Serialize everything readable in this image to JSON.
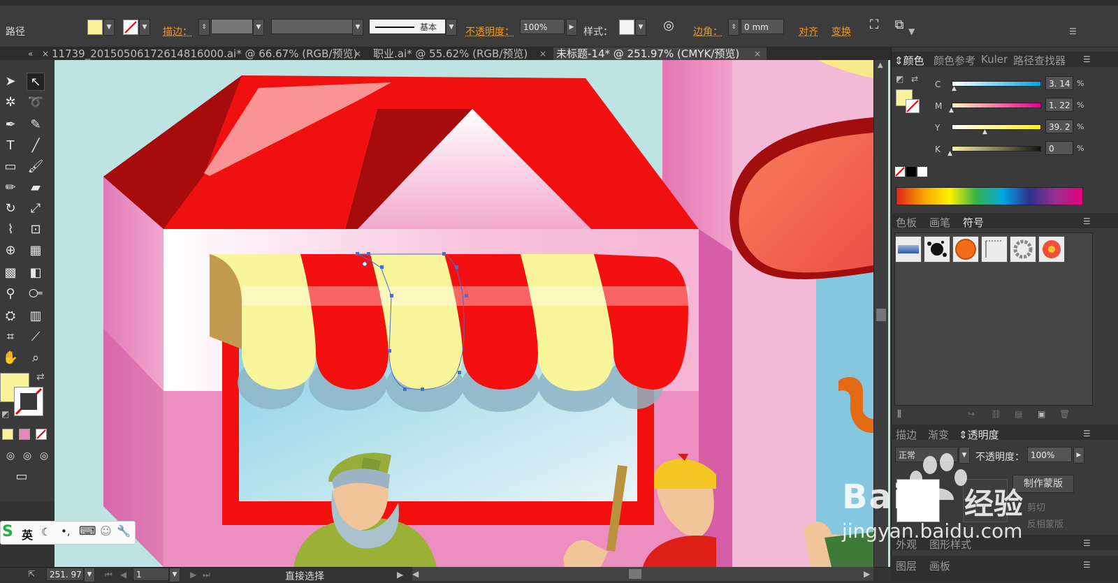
{
  "control_bar": {
    "object_type": "路径",
    "stroke_label": "描边：",
    "stroke_profile": "基本",
    "opacity_label": "不透明度：",
    "opacity_value": "100%",
    "style_label": "样式：",
    "corner_label": "边角：",
    "corner_value": "0 mm",
    "align_label": "对齐",
    "transform_label": "变换",
    "fill_color": "#f8f29a"
  },
  "tabs": [
    {
      "label": "11739_20150506172614816000.ai* @ 66.67% (RGB/预览)"
    },
    {
      "label": "职业.ai* @ 55.62% (RGB/预览)"
    },
    {
      "label": "未标题-14* @ 251.97% (CMYK/预览)"
    }
  ],
  "color_panel": {
    "tabs": [
      "颜色",
      "颜色参考",
      "Kuler",
      "路径查找器"
    ],
    "channels": [
      {
        "name": "C",
        "value": "3. 14",
        "pos": 0.03
      },
      {
        "name": "M",
        "value": "1. 22",
        "pos": 0.01
      },
      {
        "name": "Y",
        "value": "39. 2",
        "pos": 0.39
      },
      {
        "name": "K",
        "value": "0",
        "pos": 0.0
      }
    ],
    "percent": "%"
  },
  "symbols_panel": {
    "tabs": [
      "色板",
      "画笔",
      "符号"
    ]
  },
  "transparency_panel": {
    "tabs": [
      "描边",
      "渐变",
      "透明度"
    ],
    "blend_mode": "正常",
    "opacity_label": "不透明度：",
    "opacity_value": "100%",
    "make_mask": "制作蒙版",
    "clip": "剪切",
    "invert_mask": "反相蒙版"
  },
  "bottom_panels": {
    "row1": [
      "外观",
      "图形样式"
    ],
    "row2": [
      "图层",
      "画板"
    ]
  },
  "status_bar": {
    "zoom": "251. 97",
    "page": "1",
    "tool": "直接选择"
  },
  "ime": {
    "mode": "英"
  },
  "watermark": {
    "brand": "Bai",
    "brand_cn": "经验",
    "url": "jingyan.baidu.com"
  }
}
